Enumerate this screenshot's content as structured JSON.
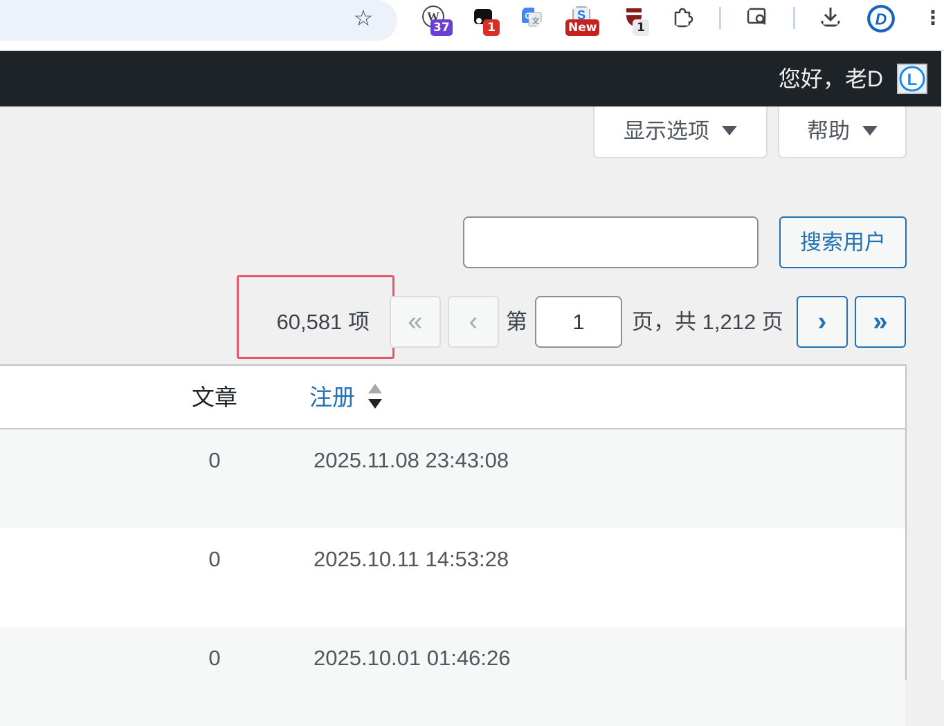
{
  "browser": {
    "extensions": [
      {
        "name": "wordpress",
        "badge": "37",
        "badge_color": "#6b3fd1"
      },
      {
        "name": "ext-black",
        "badge": "1",
        "badge_color": "#d93025"
      },
      {
        "name": "google-translate",
        "badge": "",
        "badge_color": ""
      },
      {
        "name": "ext-new",
        "badge": "New",
        "badge_color": "#c5221f"
      },
      {
        "name": "shield",
        "badge": "1",
        "badge_color": "#e8eaed"
      }
    ]
  },
  "admin_bar": {
    "greeting": "您好，老D"
  },
  "screen_meta": {
    "screen_options_label": "显示选项",
    "help_label": "帮助"
  },
  "search": {
    "value": "",
    "button_label": "搜索用户"
  },
  "pagination": {
    "item_count": "60,581 项",
    "first_label": "«",
    "prev_label": "‹",
    "page_prefix": "第",
    "current_page": "1",
    "page_suffix": "页，共 1,212 页",
    "next_label": "›",
    "last_label": "»"
  },
  "table": {
    "columns": {
      "posts": "文章",
      "registered": "注册"
    },
    "rows": [
      {
        "posts": "0",
        "registered": "2025.11.08 23:43:08"
      },
      {
        "posts": "0",
        "registered": "2025.10.11 14:53:28"
      },
      {
        "posts": "0",
        "registered": "2025.10.01 01:46:26"
      }
    ]
  },
  "colors": {
    "accent": "#2271b1",
    "admin_bar": "#1d2327",
    "highlight": "#e5586b"
  }
}
